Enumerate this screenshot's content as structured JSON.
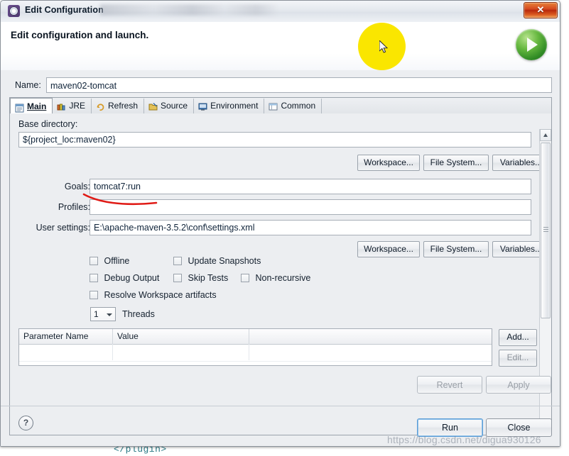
{
  "window": {
    "title": "Edit Configuration",
    "icon": "gear-icon",
    "close_label": "✕"
  },
  "banner": {
    "heading": "Edit configuration and launch.",
    "run_icon": "green-run-play-icon"
  },
  "name_field": {
    "label": "Name:",
    "value": "maven02-tomcat"
  },
  "tabs": [
    {
      "label": "Main",
      "icon": "main-document-icon",
      "active": true
    },
    {
      "label": "JRE",
      "icon": "jre-library-icon",
      "active": false
    },
    {
      "label": "Refresh",
      "icon": "refresh-arrows-icon",
      "active": false
    },
    {
      "label": "Source",
      "icon": "source-folder-icon",
      "active": false
    },
    {
      "label": "Environment",
      "icon": "environment-icon",
      "active": false
    },
    {
      "label": "Common",
      "icon": "common-window-icon",
      "active": false
    }
  ],
  "main_tab": {
    "base_directory": {
      "label": "Base directory:",
      "value": "${project_loc:maven02}"
    },
    "browse_buttons_top": [
      {
        "label": "Workspace..."
      },
      {
        "label": "File System..."
      },
      {
        "label": "Variables..."
      }
    ],
    "goals": {
      "label": "Goals:",
      "value": "tomcat7:run"
    },
    "profiles": {
      "label": "Profiles:",
      "value": ""
    },
    "user_settings": {
      "label": "User settings:",
      "value": "E:\\apache-maven-3.5.2\\conf\\settings.xml"
    },
    "browse_buttons_bottom": [
      {
        "label": "Workspace..."
      },
      {
        "label": "File System..."
      },
      {
        "label": "Variables..."
      }
    ],
    "checkboxes": [
      {
        "label": "Offline",
        "checked": false
      },
      {
        "label": "Update Snapshots",
        "checked": false
      },
      {
        "label": "Debug Output",
        "checked": false
      },
      {
        "label": "Skip Tests",
        "checked": false
      },
      {
        "label": "Non-recursive",
        "checked": false
      },
      {
        "label": "Resolve Workspace artifacts",
        "checked": false
      }
    ],
    "threads": {
      "value": "1",
      "label": "Threads"
    },
    "parameter_table": {
      "columns": [
        "Parameter Name",
        "Value"
      ],
      "rows": []
    },
    "table_buttons": [
      {
        "label": "Add...",
        "enabled": true
      },
      {
        "label": "Edit...",
        "enabled": true
      }
    ]
  },
  "footer": {
    "revert_label": "Revert",
    "revert_enabled": false,
    "apply_label": "Apply",
    "apply_enabled": false,
    "help_label": "?",
    "run_label": "Run",
    "close_label": "Close"
  },
  "annotations": {
    "red_underline": "hand-drawn red underline under goals value",
    "cursor_highlight_color": "#fae600"
  },
  "watermark": {
    "text": "https://blog.csdn.net/digua930126"
  },
  "background_editor": {
    "visible_line": "</plugin>"
  }
}
